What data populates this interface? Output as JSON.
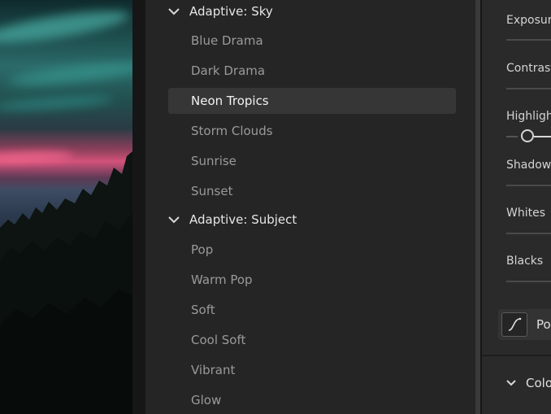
{
  "presets": {
    "groups": [
      {
        "label": "Adaptive: Sky",
        "items": [
          "Blue Drama",
          "Dark Drama",
          "Neon Tropics",
          "Storm Clouds",
          "Sunrise",
          "Sunset"
        ]
      },
      {
        "label": "Adaptive: Subject",
        "items": [
          "Pop",
          "Warm Pop",
          "Soft",
          "Cool Soft",
          "Vibrant",
          "Glow"
        ]
      }
    ],
    "selected_item": "Neon Tropics"
  },
  "edit_panel": {
    "adjustments": [
      "Exposure",
      "Contrast",
      "Highlights",
      "Shadows",
      "Whites",
      "Blacks"
    ],
    "point_curve_label": "Point Curve",
    "color_section_label": "Color"
  },
  "icons": {
    "group_toggle": "chevron-down-icon",
    "curve": "point-curve-icon"
  },
  "colors": {
    "panel_bg": "#252525",
    "selected_bg": "#363636",
    "text_primary": "#e6e6e6",
    "text_muted": "#9a9a9a"
  }
}
